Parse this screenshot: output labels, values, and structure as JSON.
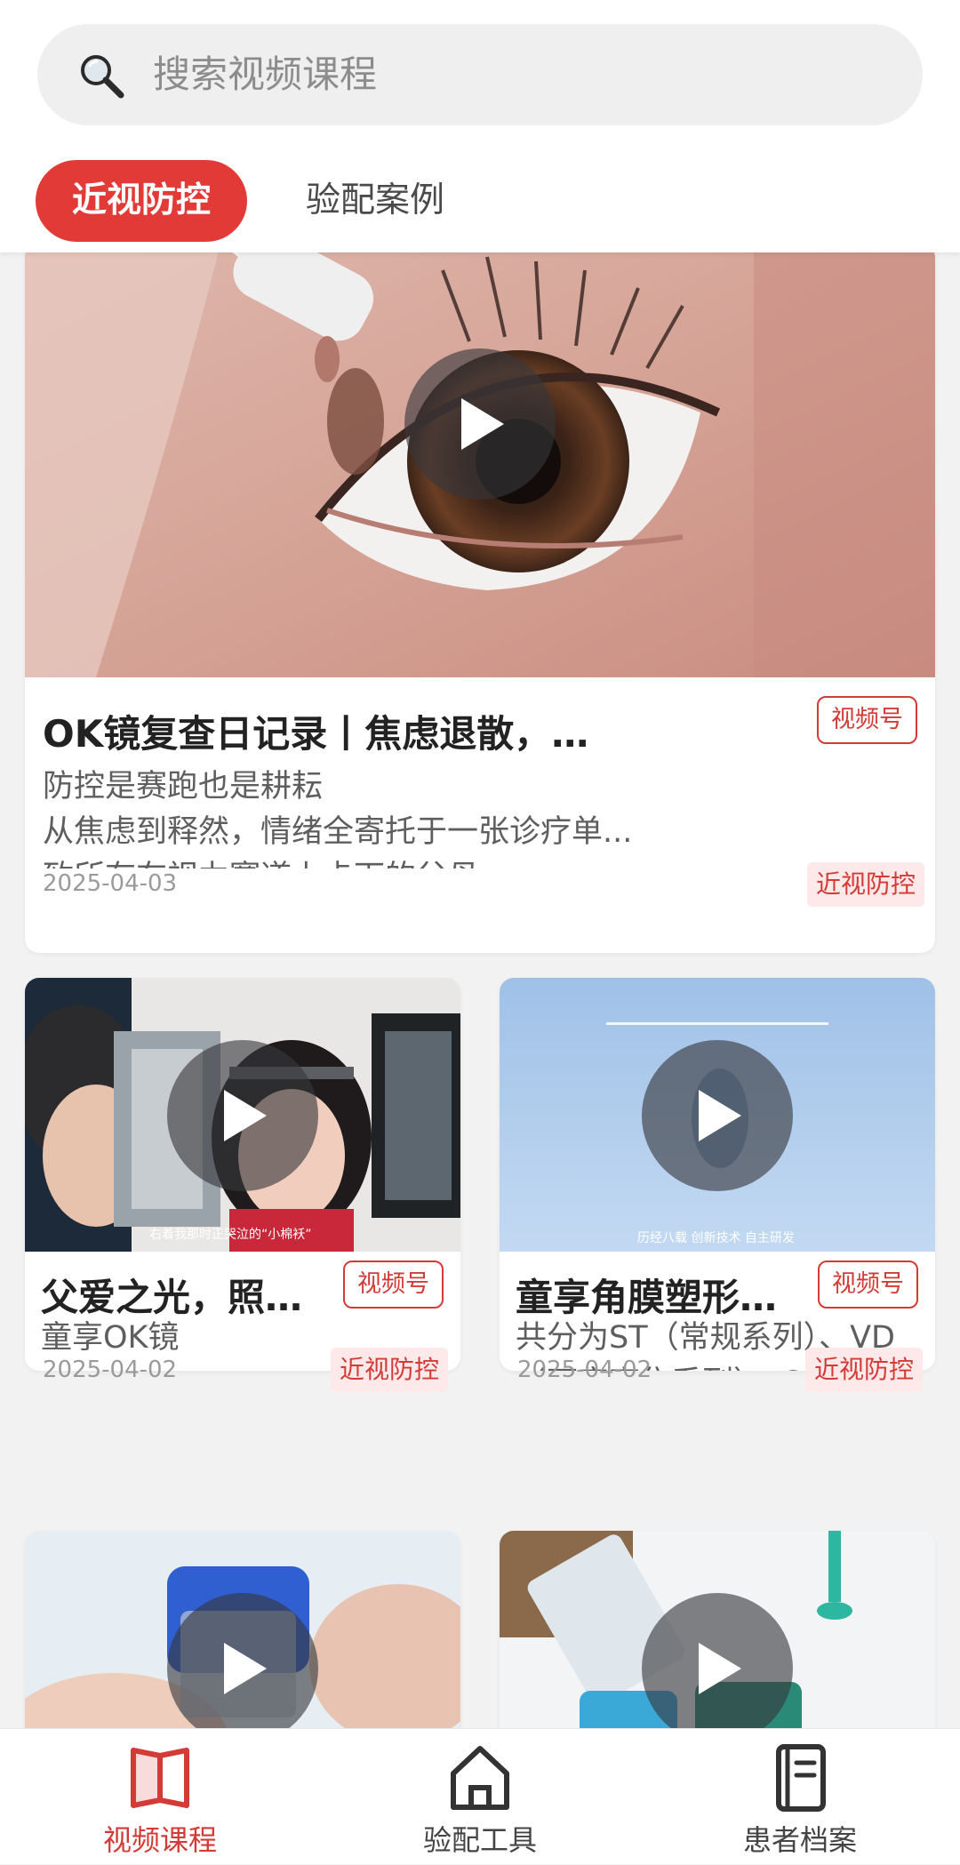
{
  "search": {
    "placeholder": "搜索视频课程"
  },
  "tabs": [
    {
      "label": "近视防控",
      "active": true
    },
    {
      "label": "验配案例",
      "active": false
    }
  ],
  "cards": [
    {
      "title": "OK镜复查日记录丨焦虑退散，未来可期",
      "badge": "视频号",
      "description_lines": [
        "防控是赛跑也是耕耘",
        "从焦虑到释然，情绪全寄托于一张诊疗单...",
        "致所有在视力赛道上卡下的父母"
      ],
      "date": "2025-04-03",
      "category": "近视防控"
    },
    {
      "title": "父爱之光，照亮...",
      "badge": "视频号",
      "description_lines": [
        "童享OK镜"
      ],
      "date": "2025-04-02",
      "category": "近视防控",
      "thumb_caption": "右着我那时正哭泣的“小棉袄”"
    },
    {
      "title": "童享角膜塑形镜...",
      "badge": "视频号",
      "description_lines": [
        "共分为ST（常规系列）、VD",
        "（可变离焦系列）、GP（自..."
      ],
      "date": "2025-04-02",
      "category": "近视防控",
      "thumb_caption": "历经八载 创新技术 自主研发"
    },
    {
      "title": "",
      "badge": "",
      "description_lines": [],
      "date": "",
      "category": ""
    },
    {
      "title": "",
      "badge": "",
      "description_lines": [],
      "date": "",
      "category": ""
    }
  ],
  "bottom_nav": [
    {
      "label": "视频课程",
      "icon": "book-icon",
      "active": true
    },
    {
      "label": "验配工具",
      "icon": "home-icon",
      "active": false
    },
    {
      "label": "患者档案",
      "icon": "notebook-icon",
      "active": false
    }
  ],
  "colors": {
    "accent": "#e23a37",
    "badge_bg": "#fde9e9"
  }
}
